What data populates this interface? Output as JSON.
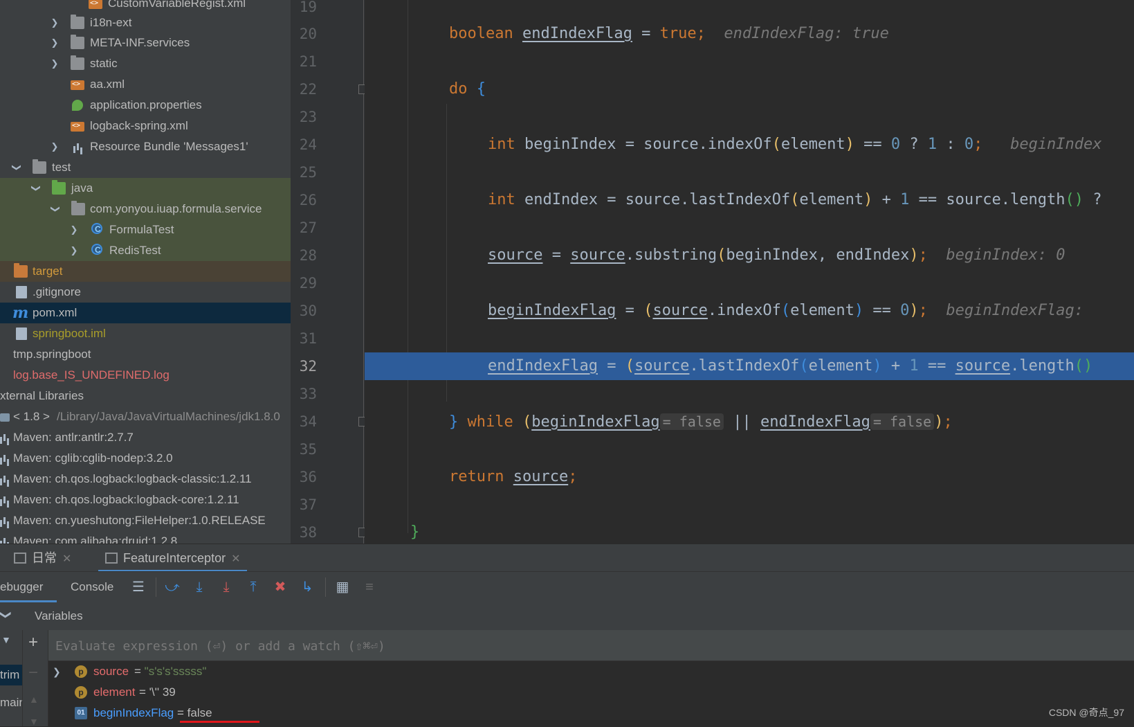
{
  "project_tree": {
    "items": [
      {
        "label": "CustomVariableRegist.xml",
        "icon": "xml-file-icon"
      },
      {
        "label": "i18n-ext",
        "icon": "folder-icon"
      },
      {
        "label": "META-INF.services",
        "icon": "folder-icon"
      },
      {
        "label": "static",
        "icon": "folder-icon"
      },
      {
        "label": "aa.xml",
        "icon": "xml-file-icon"
      },
      {
        "label": "application.properties",
        "icon": "spring-properties-icon"
      },
      {
        "label": "logback-spring.xml",
        "icon": "xml-file-icon"
      },
      {
        "label": "Resource Bundle 'Messages1'",
        "icon": "resource-bundle-icon"
      },
      {
        "label": "test",
        "icon": "folder-icon"
      },
      {
        "label": "java",
        "icon": "test-source-folder-icon"
      },
      {
        "label": "com.yonyou.iuap.formula.service",
        "icon": "package-icon"
      },
      {
        "label": "FormulaTest",
        "icon": "class-icon"
      },
      {
        "label": "RedisTest",
        "icon": "class-icon"
      },
      {
        "label": "target",
        "icon": "excluded-folder-icon"
      },
      {
        "label": ".gitignore",
        "icon": "file-icon"
      },
      {
        "label": "pom.xml",
        "icon": "maven-icon"
      },
      {
        "label": "springboot.iml",
        "icon": "module-file-icon"
      },
      {
        "label": "tmp.springboot",
        "icon": ""
      },
      {
        "label": "log.base_IS_UNDEFINED.log",
        "icon": ""
      },
      {
        "label": "xternal Libraries",
        "icon": ""
      },
      {
        "label": "< 1.8 >",
        "extra": "/Library/Java/JavaVirtualMachines/jdk1.8.0",
        "icon": "jdk-icon"
      },
      {
        "label": "Maven: antlr:antlr:2.7.7",
        "icon": "library-icon"
      },
      {
        "label": "Maven: cglib:cglib-nodep:3.2.0",
        "icon": "library-icon"
      },
      {
        "label": "Maven: ch.qos.logback:logback-classic:1.2.11",
        "icon": "library-icon"
      },
      {
        "label": "Maven: ch.qos.logback:logback-core:1.2.11",
        "icon": "library-icon"
      },
      {
        "label": "Maven: cn.yueshutong:FileHelper:1.0.RELEASE",
        "icon": "library-icon"
      },
      {
        "label": "Maven: com.alibaba:druid:1.2.8",
        "icon": "library-icon"
      }
    ]
  },
  "editor": {
    "line_numbers": [
      "19",
      "20",
      "21",
      "22",
      "23",
      "24",
      "25",
      "26",
      "27",
      "28",
      "29",
      "30",
      "31",
      "32",
      "33",
      "34",
      "35",
      "36",
      "37",
      "38"
    ],
    "current_line": "32",
    "code": {
      "l20": {
        "kw": "boolean",
        "var": "endIndexFlag",
        "op": " = ",
        "val": "true",
        "semi": ";",
        "hint": "endIndexFlag: true"
      },
      "l22": {
        "kw": "do",
        "brace": "{"
      },
      "l24": {
        "kw": "int",
        "text1": " beginIndex = source.",
        "fn": "indexOf",
        "text2": "element",
        "text3": " == ",
        "n0": "0",
        "q": " ? ",
        "n1": "1",
        "c": " : ",
        "n2": "0",
        "semi": ";",
        "hint": "beginIndex"
      },
      "l26": {
        "kw": "int",
        "text1": " endIndex = source.",
        "fn": "lastIndexOf",
        "text2": "element",
        "text3": " + ",
        "n1": "1",
        "text4": " == source.",
        "fn2": "length",
        "tail": " ?"
      },
      "l28": {
        "var": "source",
        "op": " = ",
        "var2": "source",
        "dot": ".substring",
        "args": "beginIndex, endIndex",
        "semi": ";",
        "hint": "beginIndex: 0"
      },
      "l30": {
        "var": "beginIndexFlag",
        "op": " = ",
        "var2": "source",
        "dot": ".indexOf",
        "arg": "element",
        "cmp": " == ",
        "n0": "0",
        "semi": ";",
        "hint": "beginIndexFlag: "
      },
      "l32": {
        "var": "endIndexFlag",
        "op": " = ",
        "var2": "source",
        "dot": ".lastIndexOf",
        "arg": "element",
        "plus": " + ",
        "n1": "1",
        "cmp": " == ",
        "var3": "source",
        "dot2": ".length"
      },
      "l34": {
        "brace": "}",
        "kw": "while",
        "var": "beginIndexFlag",
        "inlay1": "= false",
        "or": " || ",
        "var2": "endIndexFlag",
        "inlay2": "= false",
        "semi": ";"
      },
      "l36": {
        "kw": "return",
        "var": "source",
        "semi": ";"
      },
      "l38": {
        "brace": "}"
      }
    }
  },
  "bottom_tabs": [
    {
      "label": "日常"
    },
    {
      "label": "FeatureInterceptor"
    }
  ],
  "debug_toolbar": {
    "tabs": [
      "ebugger",
      "Console"
    ]
  },
  "variables": {
    "header": "Variables",
    "watch_placeholder": "Evaluate expression (⏎) or add a watch (⇧⌘⏎)",
    "frames": [
      "trim",
      "main"
    ],
    "rows": [
      {
        "name": "source",
        "eq": " = ",
        "value": "\"s's's'sssss\"",
        "badge": "p"
      },
      {
        "name": "element",
        "eq": " = ",
        "value": "'\\'' 39",
        "badge": "p"
      },
      {
        "name": "beginIndexFlag",
        "eq": " = ",
        "value": "false",
        "badge": "01"
      }
    ]
  },
  "watermark": "CSDN @奇点_97",
  "colors": {
    "exec_line": "#2d5c9a",
    "annotation_underline": "#e0161b"
  }
}
